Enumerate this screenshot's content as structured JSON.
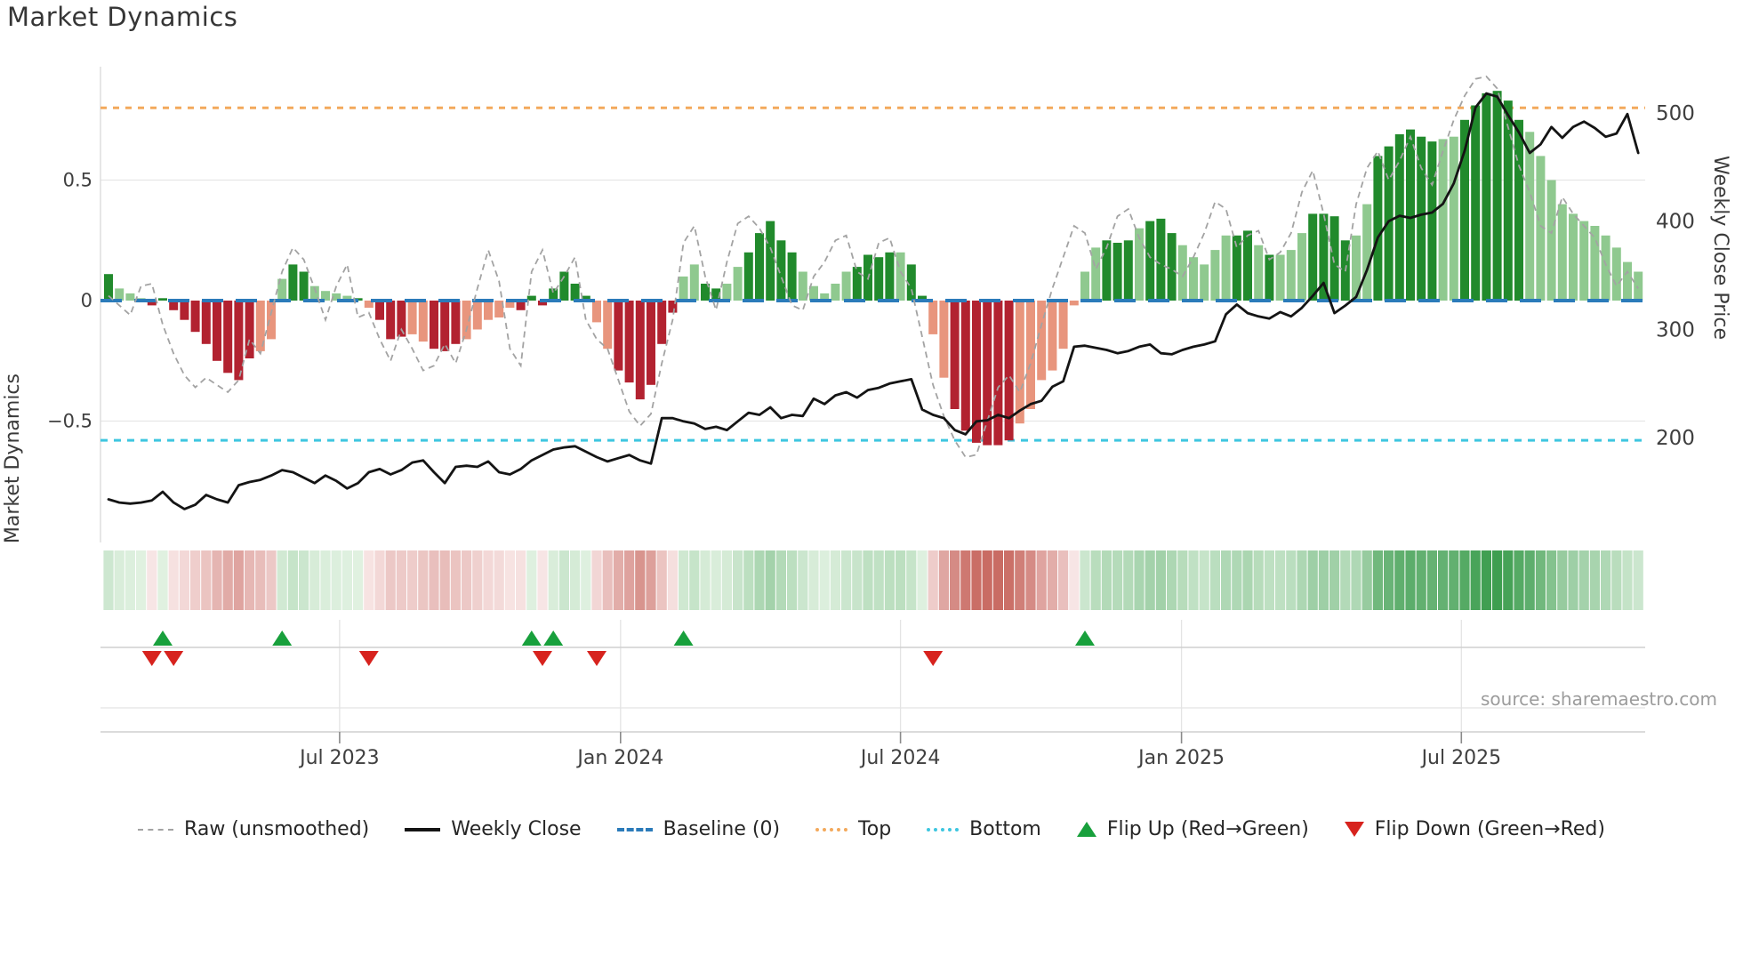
{
  "title": "Market Dynamics",
  "source_text": "source: sharemaestro.com",
  "axes": {
    "left_label": "Market Dynamics",
    "right_label": "Weekly Close Price",
    "left_ticks": [
      {
        "label": "0.5",
        "value": 0.5
      },
      {
        "label": "0",
        "value": 0
      },
      {
        "label": "−0.5",
        "value": -0.5
      }
    ],
    "right_ticks": [
      {
        "label": "500",
        "value": 500
      },
      {
        "label": "400",
        "value": 400
      },
      {
        "label": "300",
        "value": 300
      },
      {
        "label": "200",
        "value": 200
      }
    ],
    "x_ticks": [
      {
        "label": "Jul 2023",
        "week": 21.3
      },
      {
        "label": "Jan 2024",
        "week": 47.2
      },
      {
        "label": "Jul 2024",
        "week": 73.0
      },
      {
        "label": "Jan 2025",
        "week": 98.9
      },
      {
        "label": "Jul 2025",
        "week": 124.7
      }
    ]
  },
  "reference_lines": {
    "baseline": 0,
    "top": 0.8,
    "bottom": -0.58
  },
  "legend": {
    "items": [
      {
        "label": "Raw (unsmoothed)",
        "swatch": "raw"
      },
      {
        "label": "Weekly Close",
        "swatch": "close"
      },
      {
        "label": "Baseline (0)",
        "swatch": "base"
      },
      {
        "label": "Top",
        "swatch": "top"
      },
      {
        "label": "Bottom",
        "swatch": "bottom"
      },
      {
        "label": "Flip Up (Red→Green)",
        "swatch": "up"
      },
      {
        "label": "Flip Down (Green→Red)",
        "swatch": "down"
      }
    ]
  },
  "colors": {
    "bar_pos_strong": "#218a2c",
    "bar_pos_weak": "#8fc98f",
    "bar_neg_strong": "#b22230",
    "bar_neg_weak": "#e8957d",
    "baseline": "#2b7bba",
    "top_line": "#f3a95c",
    "bottom_line": "#3ec6e0",
    "raw_line": "#a3a3a3",
    "price_line": "#141414",
    "flip_up": "#18a03c",
    "flip_down": "#d7231e",
    "grid": "#e6e6e6",
    "spine": "#cfcfcf",
    "tick_text": "#3f3f3f",
    "source_text_color": "#9c9c9c"
  },
  "chart_data": {
    "type": "bar+line",
    "x_unit": "week",
    "start_date": "2023-02-06",
    "weeks": 142,
    "title": "Market Dynamics",
    "left_axis_range": [
      -0.9,
      1.0
    ],
    "right_axis_range": [
      130,
      540
    ],
    "smoothed": [
      0.11,
      0.05,
      0.03,
      0.01,
      -0.02,
      0.01,
      -0.04,
      -0.08,
      -0.13,
      -0.18,
      -0.25,
      -0.3,
      -0.33,
      -0.24,
      -0.21,
      -0.16,
      0.09,
      0.15,
      0.12,
      0.06,
      0.04,
      0.03,
      0.02,
      0.01,
      -0.03,
      -0.08,
      -0.16,
      -0.15,
      -0.14,
      -0.17,
      -0.2,
      -0.21,
      -0.18,
      -0.16,
      -0.12,
      -0.08,
      -0.07,
      -0.03,
      -0.04,
      0.02,
      -0.02,
      0.05,
      0.12,
      0.07,
      0.02,
      -0.09,
      -0.2,
      -0.29,
      -0.34,
      -0.41,
      -0.35,
      -0.18,
      -0.05,
      0.1,
      0.15,
      0.07,
      0.05,
      0.07,
      0.14,
      0.2,
      0.28,
      0.33,
      0.25,
      0.2,
      0.12,
      0.06,
      0.03,
      0.07,
      0.12,
      0.14,
      0.19,
      0.18,
      0.2,
      0.2,
      0.15,
      0.02,
      -0.14,
      -0.32,
      -0.45,
      -0.54,
      -0.59,
      -0.6,
      -0.6,
      -0.58,
      -0.51,
      -0.45,
      -0.33,
      -0.29,
      -0.2,
      -0.02,
      0.12,
      0.22,
      0.25,
      0.24,
      0.25,
      0.3,
      0.33,
      0.34,
      0.28,
      0.23,
      0.18,
      0.15,
      0.21,
      0.27,
      0.27,
      0.29,
      0.23,
      0.19,
      0.19,
      0.21,
      0.28,
      0.36,
      0.36,
      0.35,
      0.25,
      0.27,
      0.4,
      0.6,
      0.64,
      0.69,
      0.71,
      0.68,
      0.66,
      0.67,
      0.68,
      0.75,
      0.81,
      0.86,
      0.87,
      0.83,
      0.75,
      0.7,
      0.6,
      0.5,
      0.4,
      0.36,
      0.33,
      0.31,
      0.27,
      0.22,
      0.16,
      0.12
    ],
    "tone": "dlllddddddddddlllddlllldldddlldddllllldddddddllddddd dllddlldddddlllllddddlddllddddddlllllllldddldddlllllddldlllddddllddddddlldddddd lllllllllllll",
    "raw": [
      0.02,
      -0.02,
      -0.06,
      0.06,
      0.07,
      -0.1,
      -0.22,
      -0.31,
      -0.36,
      -0.32,
      -0.35,
      -0.38,
      -0.33,
      -0.16,
      -0.22,
      -0.05,
      0.12,
      0.22,
      0.17,
      0.05,
      -0.08,
      0.06,
      0.15,
      -0.07,
      -0.05,
      -0.16,
      -0.25,
      -0.12,
      -0.2,
      -0.29,
      -0.27,
      -0.18,
      -0.26,
      -0.12,
      0.05,
      0.21,
      0.08,
      -0.2,
      -0.27,
      0.12,
      0.21,
      0.03,
      0.1,
      0.18,
      -0.08,
      -0.16,
      -0.2,
      -0.33,
      -0.46,
      -0.52,
      -0.47,
      -0.26,
      -0.08,
      0.24,
      0.31,
      0.1,
      -0.04,
      0.16,
      0.32,
      0.35,
      0.3,
      0.22,
      0.1,
      -0.02,
      -0.04,
      0.1,
      0.16,
      0.25,
      0.27,
      0.12,
      0.09,
      0.24,
      0.26,
      0.12,
      0.05,
      -0.15,
      -0.35,
      -0.48,
      -0.58,
      -0.65,
      -0.64,
      -0.5,
      -0.36,
      -0.31,
      -0.38,
      -0.26,
      -0.1,
      0.05,
      0.18,
      0.31,
      0.28,
      0.13,
      0.22,
      0.35,
      0.38,
      0.26,
      0.18,
      0.15,
      0.13,
      0.1,
      0.18,
      0.28,
      0.41,
      0.38,
      0.22,
      0.27,
      0.29,
      0.17,
      0.2,
      0.28,
      0.45,
      0.54,
      0.36,
      0.15,
      0.12,
      0.4,
      0.55,
      0.62,
      0.5,
      0.58,
      0.68,
      0.55,
      0.48,
      0.62,
      0.75,
      0.85,
      0.92,
      0.93,
      0.88,
      0.72,
      0.56,
      0.45,
      0.31,
      0.28,
      0.43,
      0.36,
      0.31,
      0.26,
      0.15,
      0.06,
      0.12,
      0.05
    ],
    "price": [
      143,
      140,
      139,
      140,
      142,
      150,
      140,
      134,
      138,
      147,
      143,
      140,
      156,
      159,
      161,
      165,
      170,
      168,
      163,
      158,
      165,
      160,
      153,
      158,
      168,
      171,
      166,
      170,
      177,
      179,
      168,
      158,
      173,
      174,
      173,
      178,
      168,
      166,
      171,
      179,
      184,
      189,
      191,
      192,
      187,
      182,
      178,
      181,
      184,
      179,
      176,
      218,
      218,
      215,
      213,
      208,
      210,
      207,
      215,
      223,
      221,
      228,
      218,
      221,
      220,
      236,
      231,
      239,
      242,
      237,
      244,
      246,
      250,
      252,
      254,
      226,
      221,
      218,
      207,
      203,
      215,
      216,
      221,
      218,
      225,
      231,
      234,
      247,
      252,
      284,
      285,
      283,
      281,
      278,
      280,
      284,
      286,
      278,
      277,
      281,
      284,
      286,
      289,
      314,
      323,
      315,
      312,
      310,
      316,
      312,
      320,
      331,
      343,
      315,
      322,
      330,
      355,
      385,
      400,
      405,
      403,
      406,
      408,
      416,
      435,
      465,
      505,
      518,
      515,
      498,
      482,
      463,
      471,
      487,
      477,
      487,
      492,
      486,
      478,
      481,
      499,
      463
    ],
    "flip_up_weeks": [
      5,
      16,
      39,
      41,
      53,
      90
    ],
    "flip_down_weeks": [
      4,
      6,
      24,
      40,
      45,
      76
    ],
    "legend_position": "bottom",
    "grid": "horizontal-only"
  }
}
